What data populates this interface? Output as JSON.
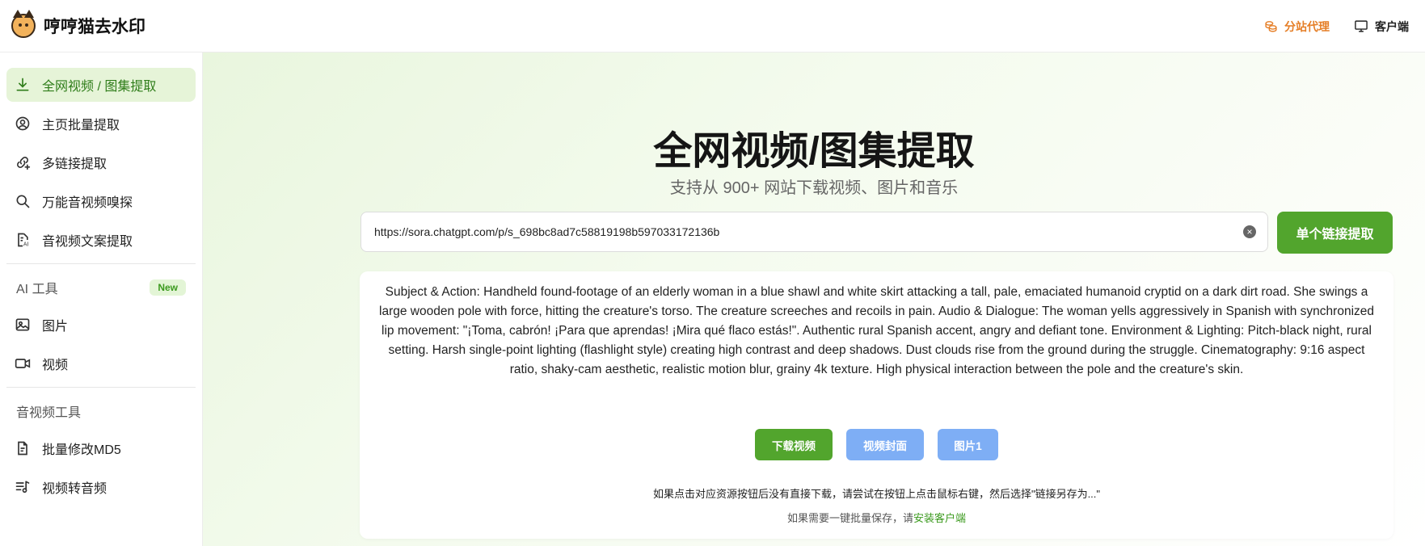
{
  "header": {
    "brand": "哼哼猫去水印",
    "agent_label": "分站代理",
    "client_label": "客户端",
    "accent_color": "#e57e26"
  },
  "sidebar": {
    "items": [
      {
        "label": "全网视频 / 图集提取",
        "icon": "download-icon",
        "active": true
      },
      {
        "label": "主页批量提取",
        "icon": "user-circle-icon"
      },
      {
        "label": "多链接提取",
        "icon": "link-plus-icon"
      },
      {
        "label": "万能音视频嗅探",
        "icon": "search-icon"
      },
      {
        "label": "音视频文案提取",
        "icon": "document-ai-icon"
      }
    ],
    "ai_section": {
      "title": "AI 工具",
      "badge": "New"
    },
    "ai_items": [
      {
        "label": "图片",
        "icon": "image-icon"
      },
      {
        "label": "视频",
        "icon": "video-icon"
      }
    ],
    "av_section": {
      "title": "音视频工具"
    },
    "av_items": [
      {
        "label": "批量修改MD5",
        "icon": "file-icon"
      },
      {
        "label": "视频转音频",
        "icon": "music-list-icon"
      }
    ]
  },
  "main": {
    "title": "全网视频/图集提取",
    "subtitle": "支持从 900+ 网站下载视频、图片和音乐",
    "search": {
      "value": "https://sora.chatgpt.com/p/s_698bc8ad7c58819198b597033172136b",
      "placeholder": ""
    },
    "extract_label": "单个链接提取",
    "result": {
      "description": "Subject & Action: Handheld found-footage of an elderly woman in a blue shawl and white skirt attacking a tall, pale, emaciated humanoid cryptid on a dark dirt road. She swings a large wooden pole with force, hitting the creature's torso. The creature screeches and recoils in pain. Audio & Dialogue: The woman yells aggressively in Spanish with synchronized lip movement: \"¡Toma, cabrón! ¡Para que aprendas! ¡Mira qué flaco estás!\". Authentic rural Spanish accent, angry and defiant tone. Environment & Lighting: Pitch-black night, rural setting. Harsh single-point lighting (flashlight style) creating high contrast and deep shadows. Dust clouds rise from the ground during the struggle. Cinematography: 9:16 aspect ratio, shaky-cam aesthetic, realistic motion blur, grainy 4k texture. High physical interaction between the pole and the creature's skin.",
      "download_video_label": "下载视频",
      "video_cover_label": "视频封面",
      "image_label": "图片1",
      "hint1": "如果点击对应资源按钮后没有直接下载，请尝试在按钮上点击鼠标右键，然后选择\"链接另存为...\"",
      "hint2_prefix": "如果需要一键批量保存，请",
      "hint2_link": "安装客户端"
    },
    "colors": {
      "primary_green": "#52a52d",
      "secondary_blue": "#7eaef5"
    }
  }
}
